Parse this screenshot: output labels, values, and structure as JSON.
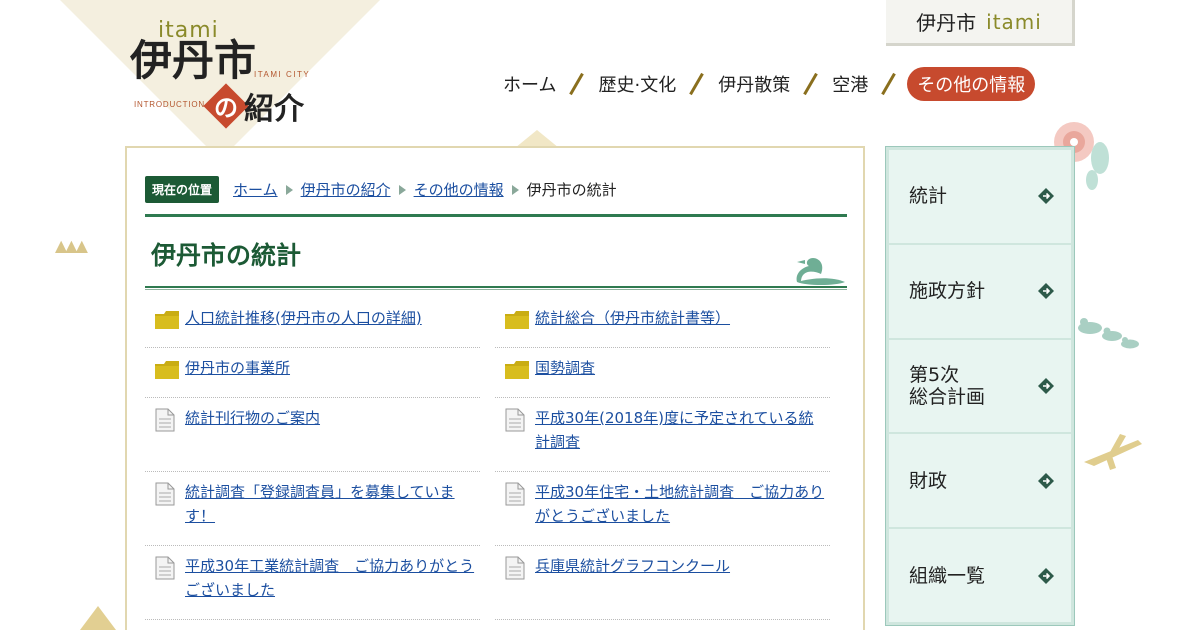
{
  "logo": {
    "itami": "itami",
    "main": "伊丹市",
    "city": "ITAMI CITY",
    "intro": "INTRODUCTION",
    "no": "の",
    "shokai": "紹介"
  },
  "badge": {
    "city": "伊丹市",
    "itami": "itami"
  },
  "gnav": {
    "items": [
      "ホーム",
      "歴史·文化",
      "伊丹散策",
      "空港"
    ],
    "active": "その他の情報"
  },
  "breadcrumb": {
    "label": "現在の位置",
    "links": [
      "ホーム",
      "伊丹市の紹介",
      "その他の情報"
    ],
    "current": "伊丹市の統計"
  },
  "page": {
    "title": "伊丹市の統計"
  },
  "links": [
    {
      "label": "人口統計推移(伊丹市の人口の詳細)",
      "icon": "folder-icon"
    },
    {
      "label": "統計総合（伊丹市統計書等）",
      "icon": "folder-icon"
    },
    {
      "label": "伊丹市の事業所",
      "icon": "folder-icon"
    },
    {
      "label": "国勢調査",
      "icon": "folder-icon"
    },
    {
      "label": "統計刊行物のご案内",
      "icon": "page-icon"
    },
    {
      "label": "平成30年(2018年)度に予定されている統計調査",
      "icon": "page-icon"
    },
    {
      "label": "統計調査「登録調査員」を募集しています！",
      "icon": "page-icon"
    },
    {
      "label": "平成30年住宅・土地統計調査　ご協力ありがとうございました",
      "icon": "page-icon"
    },
    {
      "label": "平成30年工業統計調査　ご協力ありがとうございました",
      "icon": "page-icon"
    },
    {
      "label": "兵庫県統計グラフコンクール",
      "icon": "page-icon"
    }
  ],
  "side": {
    "items": [
      "統計",
      "施政方針",
      "第5次\n総合計画",
      "財政",
      "組織一覧"
    ]
  },
  "colors": {
    "accent_green": "#1c5a35",
    "accent_red": "#c74a2e",
    "link": "#1c4fa0",
    "side_bg": "#e8f5f1"
  }
}
